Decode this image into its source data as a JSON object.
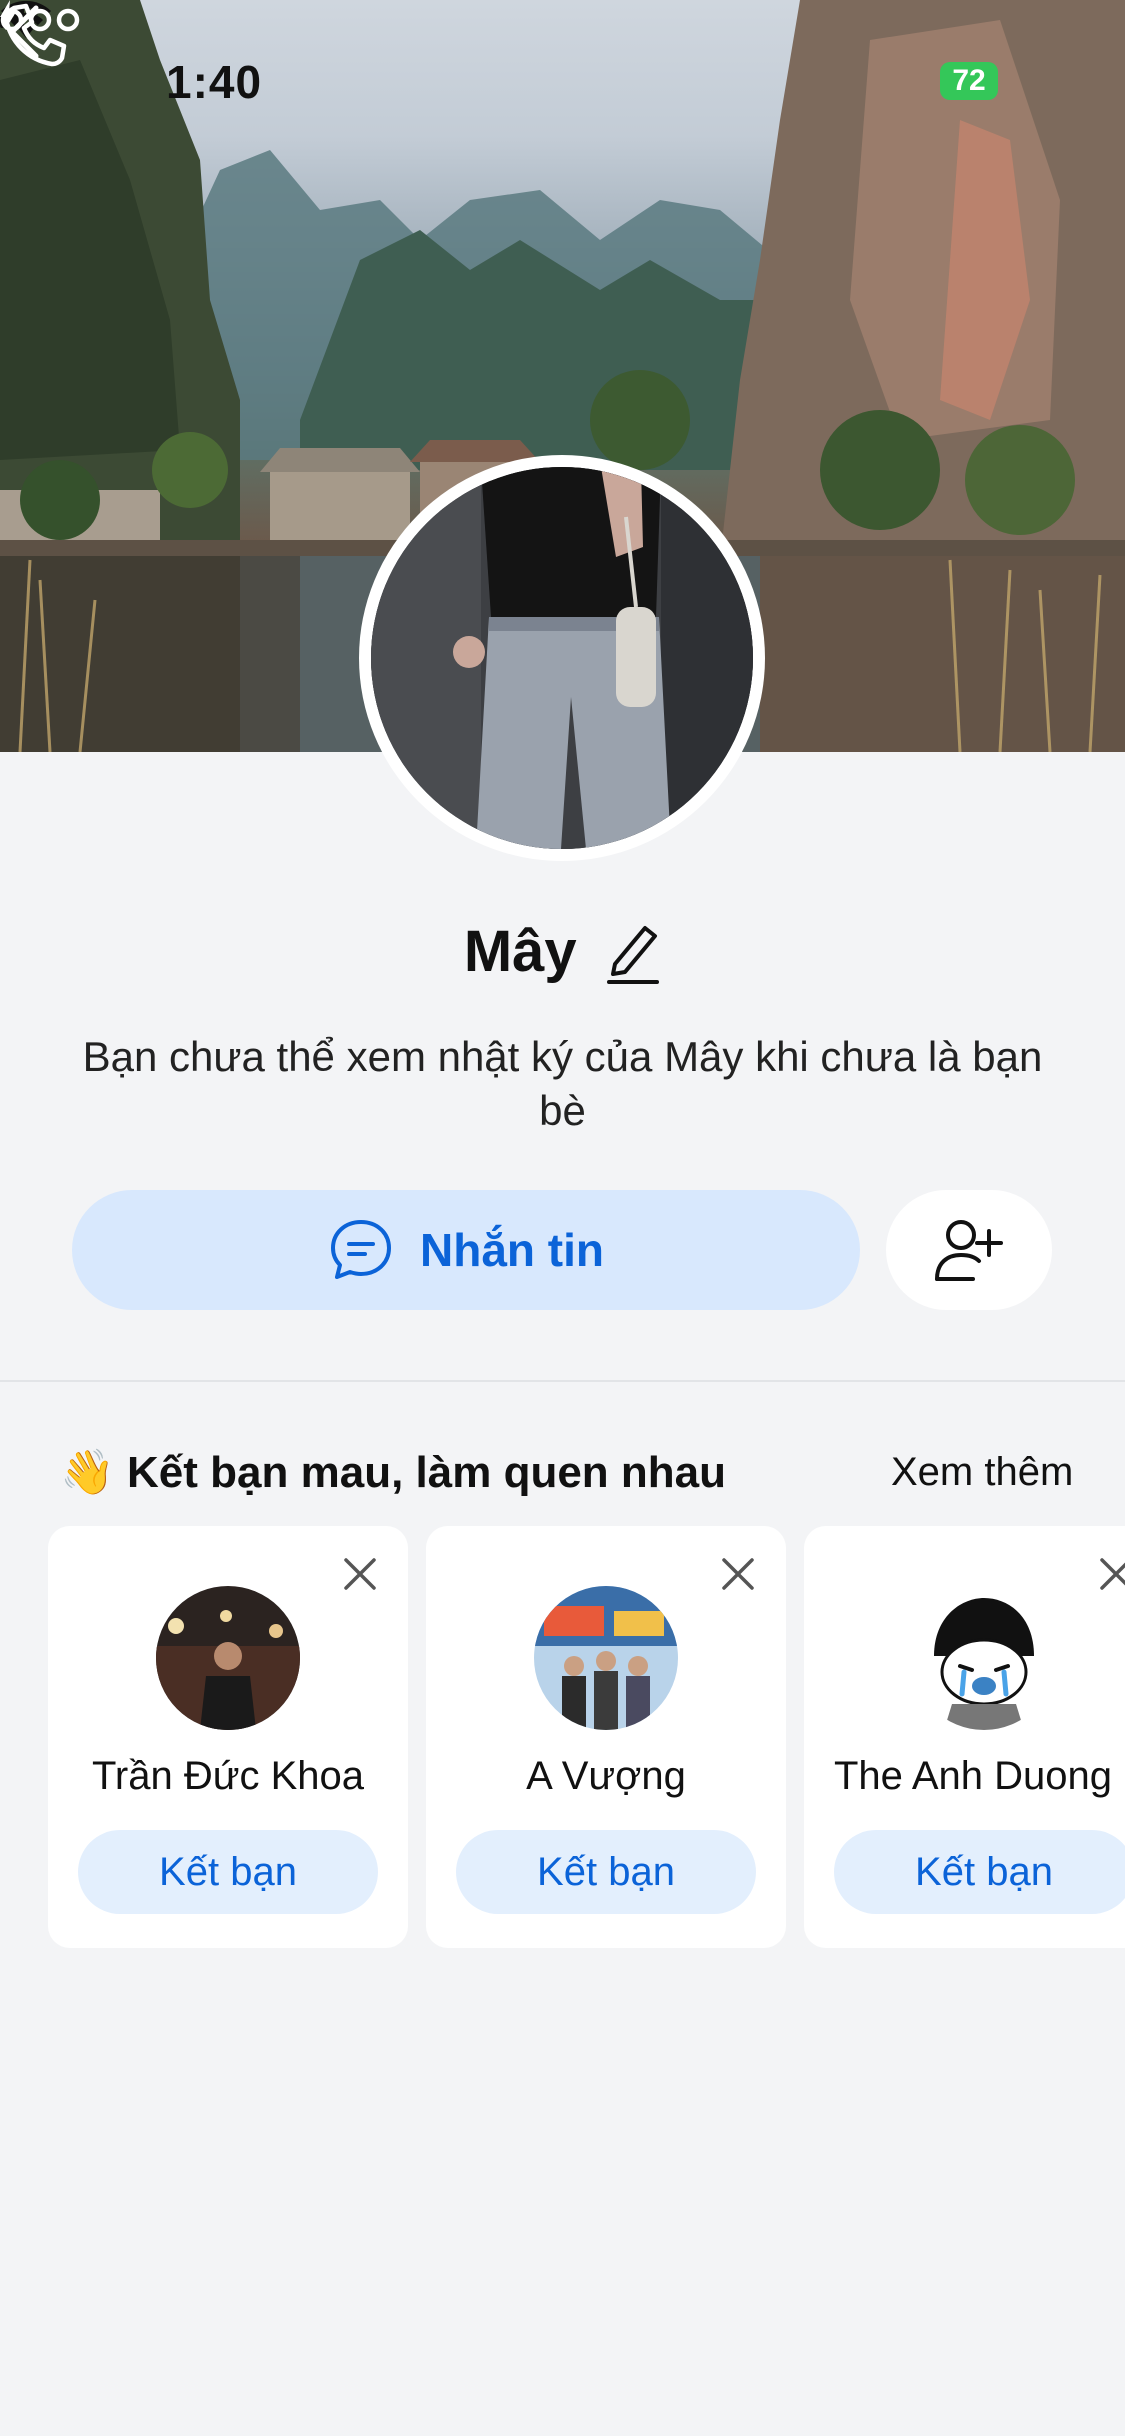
{
  "status_bar": {
    "time": "1:40",
    "battery": "72"
  },
  "profile": {
    "name": "Mây",
    "notice": "Bạn chưa thể xem nhật ký của Mây khi chưa là bạn bè"
  },
  "actions": {
    "message_label": "Nhắn tin"
  },
  "suggestions": {
    "title": "Kết bạn mau, làm quen nhau",
    "see_more": "Xem thêm",
    "items": [
      {
        "name": "Trần Đức Khoa",
        "button": "Kết bạn"
      },
      {
        "name": "A Vượng",
        "button": "Kết bạn"
      },
      {
        "name": "The Anh Duong",
        "button": "Kết bạn"
      }
    ]
  },
  "colors": {
    "accent": "#0b63d8",
    "button_bg": "#d8e8fd",
    "page_bg": "#f3f4f6",
    "battery": "#34c759"
  },
  "icons": {
    "back": "chevron-left-icon",
    "call": "phone-icon",
    "more": "more-dots-icon",
    "edit": "pencil-icon",
    "message": "chat-bubble-icon",
    "add_friend": "person-plus-icon",
    "wave": "waving-hand-icon",
    "close": "close-icon"
  }
}
